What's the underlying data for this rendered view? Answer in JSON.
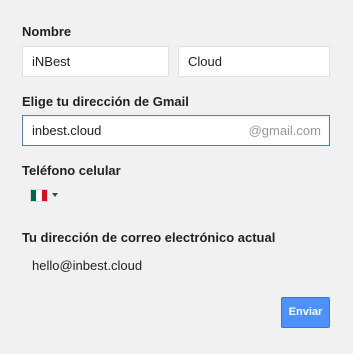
{
  "form": {
    "name_label": "Nombre",
    "first_name_value": "iNBest",
    "last_name_value": "Cloud",
    "gmail_label": "Elige tu dirección de Gmail",
    "gmail_value": "inbest.cloud",
    "gmail_suffix": "@gmail.com",
    "phone_label": "Teléfono celular",
    "phone_country_icon": "mexico-flag-icon",
    "email_label": "Tu dirección de correo electrónico actual",
    "email_value": "hello@inbest.cloud",
    "submit_label": "Enviar"
  },
  "colors": {
    "accent": "#4d90fe",
    "flag_green": "#006847",
    "flag_white": "#ffffff",
    "flag_red": "#ce1126"
  }
}
